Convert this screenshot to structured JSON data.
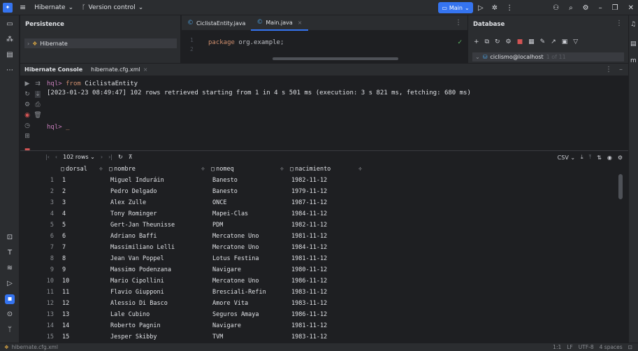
{
  "titlebar": {
    "project": "Hibernate",
    "vcs": "Version control",
    "run_config": "Main"
  },
  "persistence": {
    "title": "Persistence",
    "tree_item": "Hibernate"
  },
  "editor": {
    "tabs": [
      {
        "label": "CiclistaEntity.java"
      },
      {
        "label": "Main.java"
      }
    ],
    "line_numbers": [
      "1",
      "2"
    ],
    "code_keyword": "package",
    "code_rest": " org.example;"
  },
  "database": {
    "title": "Database",
    "datasource": "ciclismo@localhost",
    "datasource_count": "1 of 11"
  },
  "console": {
    "tabs": [
      {
        "label": "Hibernate Console"
      },
      {
        "label": "hibernate.cfg.xml"
      }
    ],
    "prompt": "hql>",
    "query_keyword": "from",
    "query_entity": "CiclistaEntity",
    "result_message": "[2023-01-23 08:49:47] 102 rows retrieved starting from 1 in 4 s 501 ms (execution: 3 s 821 ms, fetching: 680 ms)",
    "prompt2": "hql>",
    "cursor": "_"
  },
  "results": {
    "rows_label": "102 rows",
    "export_format": "CSV",
    "columns": [
      "dorsal",
      "nombre",
      "nomeq",
      "nacimiento"
    ],
    "rows": [
      [
        "1",
        "1",
        "Miguel Induráin",
        "Banesto",
        "1982-11-12"
      ],
      [
        "2",
        "2",
        "Pedro Delgado",
        "Banesto",
        "1979-11-12"
      ],
      [
        "3",
        "3",
        "Alex Zulle",
        "ONCE",
        "1987-11-12"
      ],
      [
        "4",
        "4",
        "Tony Rominger",
        "Mapei-Clas",
        "1984-11-12"
      ],
      [
        "5",
        "5",
        "Gert-Jan Theunisse",
        "PDM",
        "1982-11-12"
      ],
      [
        "6",
        "6",
        "Adriano Baffi",
        "Mercatone Uno",
        "1981-11-12"
      ],
      [
        "7",
        "7",
        "Massimiliano Lelli",
        "Mercatone Uno",
        "1984-11-12"
      ],
      [
        "8",
        "8",
        "Jean Van Poppel",
        "Lotus Festina",
        "1981-11-12"
      ],
      [
        "9",
        "9",
        "Massimo Podenzana",
        "Navigare",
        "1980-11-12"
      ],
      [
        "10",
        "10",
        "Mario Cipollini",
        "Mercatone Uno",
        "1986-11-12"
      ],
      [
        "11",
        "11",
        "Flavio Giupponi",
        "Bresciali-Refin",
        "1983-11-12"
      ],
      [
        "12",
        "12",
        "Alessio Di Basco",
        "Amore Vita",
        "1983-11-12"
      ],
      [
        "13",
        "13",
        "Lale Cubino",
        "Seguros Amaya",
        "1986-11-12"
      ],
      [
        "14",
        "14",
        "Roberto Pagnin",
        "Navigare",
        "1981-11-12"
      ],
      [
        "15",
        "15",
        "Jesper Skibby",
        "TVM",
        "1983-11-12"
      ]
    ]
  },
  "statusbar": {
    "file": "hibernate.cfg.xml",
    "position": "1:1",
    "line_sep": "LF",
    "encoding": "UTF-8",
    "indent": "4 spaces"
  },
  "colors": {
    "accent": "#3574f0",
    "background": "#1e1f22",
    "panel": "#2b2d30",
    "keyword": "#cf8e6d",
    "prompt": "#c77dbb"
  }
}
